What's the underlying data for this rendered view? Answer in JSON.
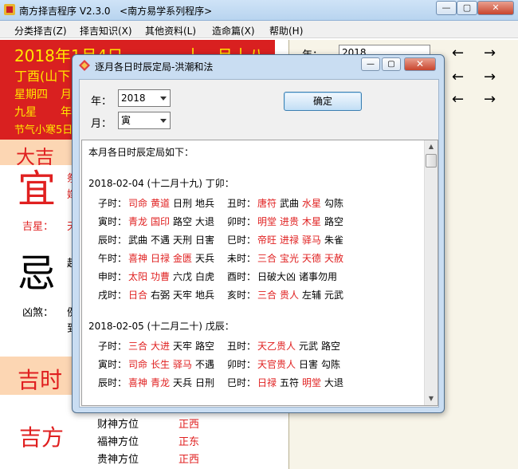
{
  "window": {
    "title": "南方择吉程序 V2.3.0",
    "subtitle": "<南方易学系列程序>",
    "minimize_label": "—",
    "maximize_label": "▢",
    "close_label": "✕"
  },
  "menu": [
    "分类择吉(Z)",
    "择吉知识(X)",
    "其他资料(L)",
    "造命篇(X)",
    "帮助(H)"
  ],
  "date_panel": {
    "solar_date": "2018年1月4日",
    "lunar_date": "十一月十八",
    "ganzhi": "丁酉(山下",
    "weekday": "星期四",
    "col2_a": "月",
    "star": "九星",
    "col2_b": "年",
    "solar_term": "节气小寒5日"
  },
  "right_panel": {
    "year_label": "年：",
    "year_value": "2018",
    "arrows": [
      "←",
      "→",
      "←",
      "→",
      "←",
      "→"
    ]
  },
  "sections": {
    "daji": "大吉",
    "yi": "宜",
    "yi_items": [
      "祭",
      "嫁"
    ],
    "jixing_label": "吉星：",
    "jixing_value": "天",
    "ji": "忌",
    "ji_item": "起",
    "xiongsha_label": "凶煞：",
    "xiongsha_items": [
      "例",
      "到"
    ],
    "jishi": "吉时",
    "jifang": "吉方",
    "directions": [
      {
        "label": "财神方位",
        "value": "正西"
      },
      {
        "label": "福神方位",
        "value": "正东"
      },
      {
        "label": "贵神方位",
        "value": "正西"
      }
    ]
  },
  "dialog": {
    "title": "逐月各日时辰定局-洪潮和法",
    "year_label": "年：",
    "year_value": "2018",
    "month_label": "月：",
    "month_value": "寅",
    "ok_label": "确定",
    "intro": "本月各日时辰定局如下：",
    "days": [
      {
        "header": "2018-02-04 (十二月十九) 丁卯：",
        "rows": [
          {
            "left": {
              "hour": "子时：",
              "words": [
                {
                  "t": "司命",
                  "red": true
                },
                {
                  "t": "黄道",
                  "red": true
                },
                {
                  "t": "日刑",
                  "red": false
                },
                {
                  "t": "地兵",
                  "red": false
                }
              ]
            },
            "right": {
              "hour": "丑时：",
              "words": [
                {
                  "t": "唐符",
                  "red": true
                },
                {
                  "t": "武曲",
                  "red": false
                },
                {
                  "t": "水星",
                  "red": true
                },
                {
                  "t": "勾陈",
                  "red": false
                }
              ]
            }
          },
          {
            "left": {
              "hour": "寅时：",
              "words": [
                {
                  "t": "青龙",
                  "red": true
                },
                {
                  "t": "国印",
                  "red": true
                },
                {
                  "t": "路空",
                  "red": false
                },
                {
                  "t": "大退",
                  "red": false
                }
              ]
            },
            "right": {
              "hour": "卯时：",
              "words": [
                {
                  "t": "明堂",
                  "red": true
                },
                {
                  "t": "进贵",
                  "red": true
                },
                {
                  "t": "木星",
                  "red": true
                },
                {
                  "t": "路空",
                  "red": false
                }
              ]
            }
          },
          {
            "left": {
              "hour": "辰时：",
              "words": [
                {
                  "t": "武曲",
                  "red": false
                },
                {
                  "t": "不遇",
                  "red": false
                },
                {
                  "t": "天刑",
                  "red": false
                },
                {
                  "t": "日害",
                  "red": false
                }
              ]
            },
            "right": {
              "hour": "巳时：",
              "words": [
                {
                  "t": "帝旺",
                  "red": true
                },
                {
                  "t": "进禄",
                  "red": true
                },
                {
                  "t": "驿马",
                  "red": true
                },
                {
                  "t": "朱雀",
                  "red": false
                }
              ]
            }
          },
          {
            "left": {
              "hour": "午时：",
              "words": [
                {
                  "t": "喜神",
                  "red": true
                },
                {
                  "t": "日禄",
                  "red": true
                },
                {
                  "t": "金匮",
                  "red": true
                },
                {
                  "t": "天兵",
                  "red": false
                }
              ]
            },
            "right": {
              "hour": "未时：",
              "words": [
                {
                  "t": "三合",
                  "red": true
                },
                {
                  "t": "宝光",
                  "red": true
                },
                {
                  "t": "天德",
                  "red": true
                },
                {
                  "t": "天赦",
                  "red": true
                }
              ]
            }
          },
          {
            "left": {
              "hour": "申时：",
              "words": [
                {
                  "t": "太阳",
                  "red": true
                },
                {
                  "t": "功曹",
                  "red": true
                },
                {
                  "t": "六戊",
                  "red": false
                },
                {
                  "t": "白虎",
                  "red": false
                }
              ]
            },
            "right": {
              "hour": "酉时：",
              "words": [
                {
                  "t": "日破大凶",
                  "red": false
                },
                {
                  "t": "诸事勿用",
                  "red": false
                }
              ]
            }
          },
          {
            "left": {
              "hour": "戌时：",
              "words": [
                {
                  "t": "日合",
                  "red": true
                },
                {
                  "t": "右弼",
                  "red": false
                },
                {
                  "t": "天牢",
                  "red": false
                },
                {
                  "t": "地兵",
                  "red": false
                }
              ]
            },
            "right": {
              "hour": "亥时：",
              "words": [
                {
                  "t": "三合",
                  "red": true
                },
                {
                  "t": "贵人",
                  "red": true
                },
                {
                  "t": "左辅",
                  "red": false
                },
                {
                  "t": "元武",
                  "red": false
                }
              ]
            }
          }
        ]
      },
      {
        "header": "2018-02-05 (十二月二十) 戊辰：",
        "rows": [
          {
            "left": {
              "hour": "子时：",
              "words": [
                {
                  "t": "三合",
                  "red": true
                },
                {
                  "t": "大进",
                  "red": true
                },
                {
                  "t": "天牢",
                  "red": false
                },
                {
                  "t": "路空",
                  "red": false
                }
              ]
            },
            "right": {
              "hour": "丑时：",
              "words": [
                {
                  "t": "天乙贵人",
                  "red": true
                },
                {
                  "t": "元武",
                  "red": false
                },
                {
                  "t": "路空",
                  "red": false
                }
              ]
            }
          },
          {
            "left": {
              "hour": "寅时：",
              "words": [
                {
                  "t": "司命",
                  "red": true
                },
                {
                  "t": "长生",
                  "red": true
                },
                {
                  "t": "驿马",
                  "red": true
                },
                {
                  "t": "不遇",
                  "red": false
                }
              ]
            },
            "right": {
              "hour": "卯时：",
              "words": [
                {
                  "t": "天官贵人",
                  "red": true
                },
                {
                  "t": "日害",
                  "red": false
                },
                {
                  "t": "勾陈",
                  "red": false
                }
              ]
            }
          },
          {
            "left": {
              "hour": "辰时：",
              "words": [
                {
                  "t": "喜神",
                  "red": true
                },
                {
                  "t": "青龙",
                  "red": true
                },
                {
                  "t": "天兵",
                  "red": false
                },
                {
                  "t": "日刑",
                  "red": false
                }
              ]
            },
            "right": {
              "hour": "巳时：",
              "words": [
                {
                  "t": "日禄",
                  "red": true
                },
                {
                  "t": "五符",
                  "red": false
                },
                {
                  "t": "明堂",
                  "red": true
                },
                {
                  "t": "大退",
                  "red": false
                }
              ]
            }
          }
        ]
      }
    ]
  }
}
